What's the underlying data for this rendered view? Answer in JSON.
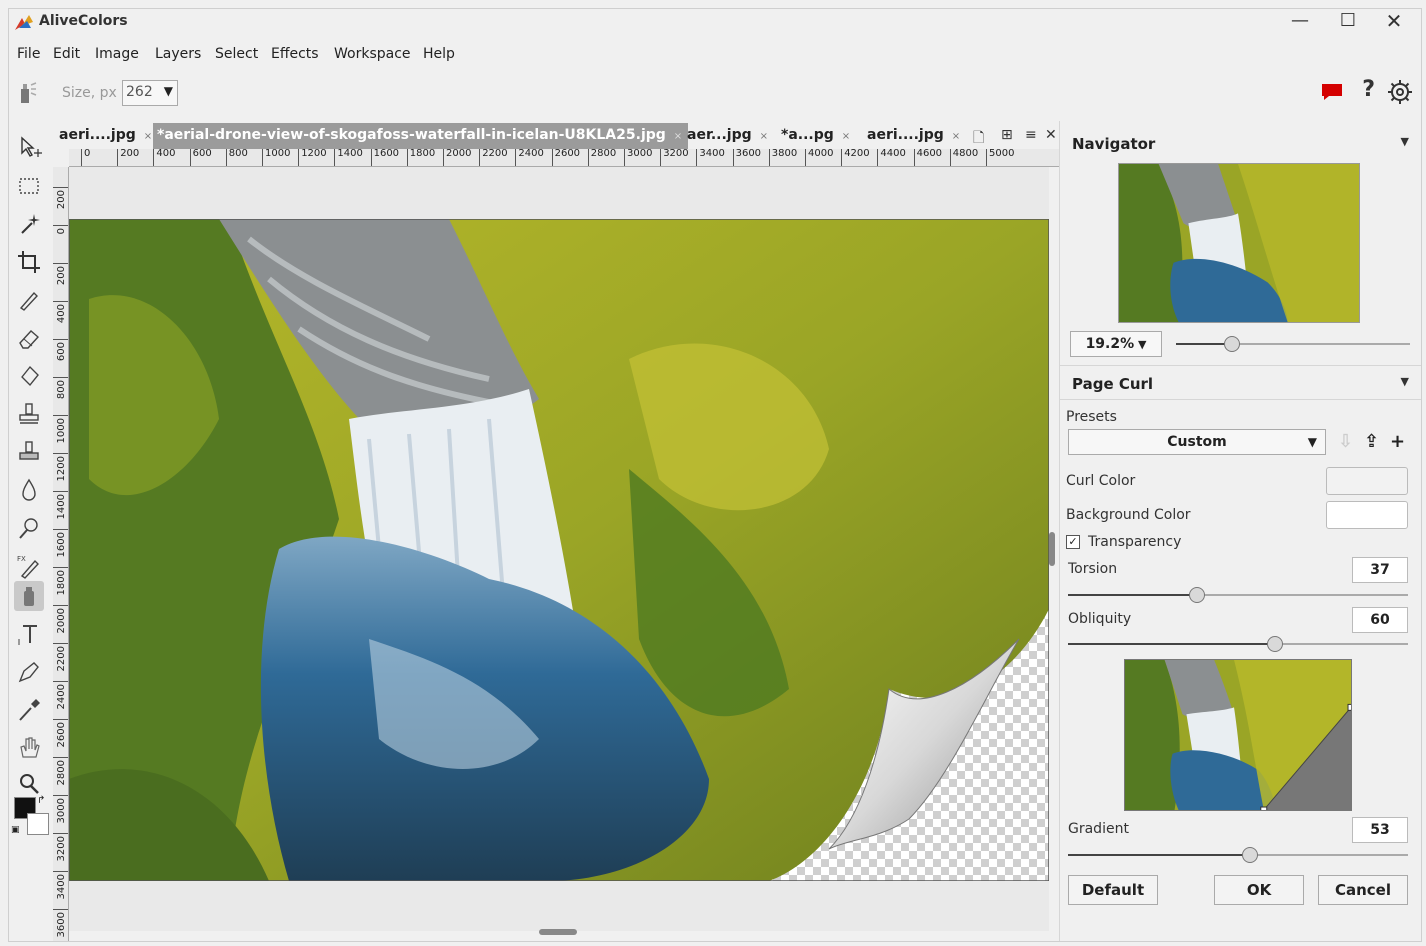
{
  "app": {
    "title": "AliveColors"
  },
  "window_controls": {
    "minimize": "—",
    "maximize": "☐",
    "close": "✕"
  },
  "menu": [
    "File",
    "Edit",
    "Image",
    "Layers",
    "Select",
    "Effects",
    "Workspace",
    "Help"
  ],
  "options": {
    "size_label": "Size, px",
    "size_value": "262"
  },
  "tabs": [
    {
      "label": "aeri....jpg",
      "active": false
    },
    {
      "label": "*aerial-drone-view-of-skogafoss-waterfall-in-icelan-U8KLA25.jpg",
      "active": true
    },
    {
      "label": "aer...jpg",
      "active": false
    },
    {
      "label": "*a...pg",
      "active": false
    },
    {
      "label": "aeri....jpg",
      "active": false
    }
  ],
  "tab_close": "×",
  "ruler_top": [
    "0",
    "200",
    "400",
    "600",
    "800",
    "1000",
    "1200",
    "1400",
    "1600",
    "1800",
    "2000",
    "2200",
    "2400",
    "2600",
    "2800",
    "3000",
    "3200",
    "3400",
    "3600",
    "3800",
    "4000",
    "4200",
    "4400",
    "4600",
    "4800",
    "5000"
  ],
  "ruler_left": [
    "200",
    "0",
    "200",
    "400",
    "600",
    "800",
    "1000",
    "1200",
    "1400",
    "1600",
    "1800",
    "2000",
    "2200",
    "2400",
    "2600",
    "2800",
    "3000",
    "3200",
    "3400",
    "3600"
  ],
  "navigator": {
    "title": "Navigator",
    "zoom": "19.2%",
    "zoom_slider": 0.24
  },
  "page_curl": {
    "title": "Page Curl",
    "presets_label": "Presets",
    "preset_value": "Custom",
    "curl_color_label": "Curl Color",
    "curl_color": "#f2f2f2",
    "background_color_label": "Background Color",
    "background_color": "#ffffff",
    "transparency_label": "Transparency",
    "transparency_checked": true,
    "torsion_label": "Torsion",
    "torsion": "37",
    "obliquity_label": "Obliquity",
    "obliquity": "60",
    "gradient_label": "Gradient",
    "gradient": "53",
    "buttons": {
      "default": "Default",
      "ok": "OK",
      "cancel": "Cancel"
    }
  },
  "colors": {
    "accent_red": "#d40000",
    "moss": "#a8b020",
    "water": "#2b5f8a"
  }
}
